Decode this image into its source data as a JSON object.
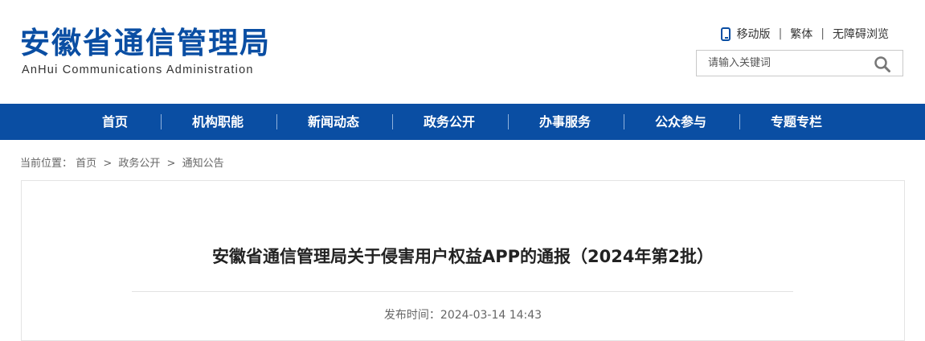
{
  "site": {
    "name_cn": "安徽省通信管理局",
    "name_en": "AnHui Communications Administration"
  },
  "toplinks": {
    "mobile": "移动版",
    "traditional": "繁体",
    "accessible": "无障碍浏览"
  },
  "search": {
    "placeholder": "请输入关键词",
    "icon": "search-icon"
  },
  "nav": {
    "items": [
      {
        "label": "首页"
      },
      {
        "label": "机构职能"
      },
      {
        "label": "新闻动态"
      },
      {
        "label": "政务公开"
      },
      {
        "label": "办事服务"
      },
      {
        "label": "公众参与"
      },
      {
        "label": "专题专栏"
      }
    ]
  },
  "breadcrumb": {
    "prefix": "当前位置：",
    "items": [
      "首页",
      "政务公开",
      "通知公告"
    ],
    "separator": ">"
  },
  "article": {
    "title": "安徽省通信管理局关于侵害用户权益APP的通报（2024年第2批）",
    "publish_label": "发布时间：",
    "publish_time": "2024-03-14 14:43"
  },
  "colors": {
    "brand": "#0a4ea3",
    "nav_bg": "#0a4ea3"
  }
}
